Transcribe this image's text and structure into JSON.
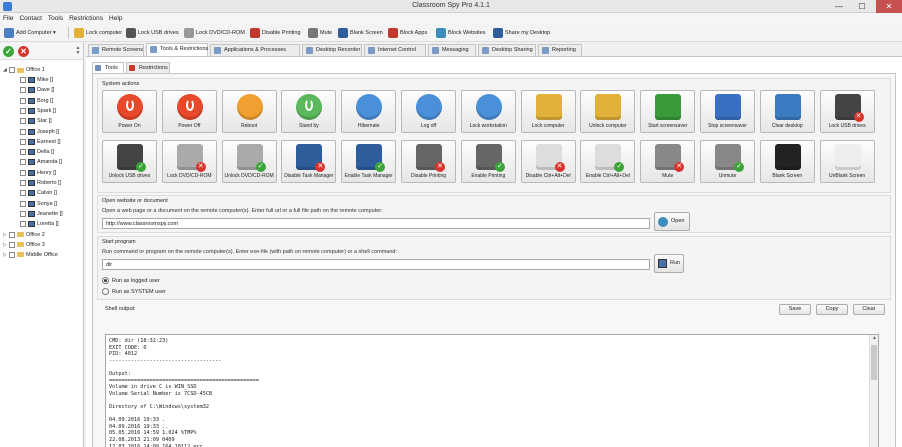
{
  "window": {
    "title": "Classroom Spy Pro 4.1.1",
    "minimize": "—",
    "maximize": "☐",
    "close": "✕"
  },
  "menu": [
    "File",
    "Contact",
    "Tools",
    "Restrictions",
    "Help"
  ],
  "toolbar": [
    {
      "label": "Add Computer ▾",
      "icon": "add-computer-icon",
      "color": "#4a7fc1"
    },
    {
      "label": "Lock computer",
      "icon": "lock-icon",
      "color": "#e0b23a"
    },
    {
      "label": "Lock USB drives",
      "icon": "usb-icon",
      "color": "#555555"
    },
    {
      "label": "Lock DVD/CD-ROM",
      "icon": "disc-icon",
      "color": "#999999"
    },
    {
      "label": "Disable Printing",
      "icon": "printer-icon",
      "color": "#c0392b"
    },
    {
      "label": "Mute",
      "icon": "speaker-icon",
      "color": "#777777"
    },
    {
      "label": "Blank Screen",
      "icon": "monitor-icon",
      "color": "#2f5d9c"
    },
    {
      "label": "Block Apps",
      "icon": "block-apps-icon",
      "color": "#c0392b"
    },
    {
      "label": "Block Websites",
      "icon": "globe-icon",
      "color": "#3c8dbc"
    },
    {
      "label": "Share my Desktop",
      "icon": "share-desktop-icon",
      "color": "#2f5d9c"
    }
  ],
  "tree": {
    "groups": [
      {
        "name": "Office 1",
        "expanded": true,
        "children": [
          "Mike []",
          "Dave []",
          "Borg []",
          "Spark []",
          "Star []",
          "Joseph []",
          "Earnest []",
          "Della []",
          "Amanda []",
          "Henry []",
          "Roberto []",
          "Calvin []",
          "Sonya []",
          "Jeanette []",
          "Loretta []"
        ]
      },
      {
        "name": "Office 2",
        "expanded": false,
        "children": []
      },
      {
        "name": "Office 3",
        "expanded": false,
        "children": []
      },
      {
        "name": "Middle Office",
        "expanded": false,
        "children": []
      }
    ]
  },
  "main_tabs": [
    "Remote Screens",
    "Tools & Restrictions",
    "Applications & Processes",
    "Desktop Recorder",
    "Internet Control",
    "Messaging",
    "Desktop Sharing",
    "Reporting"
  ],
  "active_main_tab": 1,
  "sub_tabs": [
    "Tools",
    "Restrictions"
  ],
  "system_actions": {
    "title": "System actions",
    "buttons": [
      {
        "label": "Power On",
        "icon": "power-on-icon",
        "color": "#e8492b"
      },
      {
        "label": "Power Off",
        "icon": "power-off-icon",
        "color": "#e8492b"
      },
      {
        "label": "Reboot",
        "icon": "reboot-icon",
        "color": "#f0a030"
      },
      {
        "label": "Stand by",
        "icon": "standby-icon",
        "color": "#5cb85c"
      },
      {
        "label": "Hibernate",
        "icon": "hibernate-icon",
        "color": "#4a90d9"
      },
      {
        "label": "Log off",
        "icon": "log-off-icon",
        "color": "#4a90d9"
      },
      {
        "label": "Lock workstation",
        "icon": "key-icon",
        "color": "#4a90d9"
      },
      {
        "label": "Lock computer",
        "icon": "padlock-closed-icon",
        "color": "#e0b23a"
      },
      {
        "label": "Unlock computer",
        "icon": "padlock-open-icon",
        "color": "#e0b23a"
      },
      {
        "label": "Start screensaver",
        "icon": "screensaver-start-icon",
        "color": "#3a9a3a"
      },
      {
        "label": "Stop screensaver",
        "icon": "screensaver-stop-icon",
        "color": "#3a6fc1"
      },
      {
        "label": "Clear desktop",
        "icon": "clear-desktop-icon",
        "color": "#3a7bc1"
      },
      {
        "label": "Lock USB drives",
        "icon": "usb-lock-icon",
        "color": "#444444"
      },
      {
        "label": "Unlock USB drives",
        "icon": "usb-unlock-icon",
        "color": "#444444"
      },
      {
        "label": "Lock DVD/CD-ROM",
        "icon": "dvd-lock-icon",
        "color": "#aaaaaa"
      },
      {
        "label": "Unlock DVD/CD-ROM",
        "icon": "dvd-unlock-icon",
        "color": "#aaaaaa"
      },
      {
        "label": "Disable Task Manager",
        "icon": "task-manager-disable-icon",
        "color": "#2f5d9c"
      },
      {
        "label": "Enable Task Manager",
        "icon": "task-manager-enable-icon",
        "color": "#2f5d9c"
      },
      {
        "label": "Disable Printing",
        "icon": "printer-disable-icon",
        "color": "#666666"
      },
      {
        "label": "Enable Printing",
        "icon": "printer-enable-icon",
        "color": "#666666"
      },
      {
        "label": "Disable Ctrl+Alt+Del",
        "icon": "cad-disable-icon",
        "color": "#dddddd"
      },
      {
        "label": "Enable Ctrl+Alt+Del",
        "icon": "cad-enable-icon",
        "color": "#dddddd"
      },
      {
        "label": "Mute",
        "icon": "mute-icon",
        "color": "#888888"
      },
      {
        "label": "Unmute",
        "icon": "unmute-icon",
        "color": "#888888"
      },
      {
        "label": "Blank Screen",
        "icon": "blank-screen-icon",
        "color": "#222222"
      },
      {
        "label": "UnBlank Screen",
        "icon": "unblank-screen-icon",
        "color": "#eeeeee"
      }
    ]
  },
  "open_website": {
    "title": "Open website or document",
    "instructions": "Open a web page or a document on the remote computer(s). Enter full url or a full file path on the remote computer:",
    "value": "http://www.classroomspy.com",
    "button": "Open"
  },
  "start_program": {
    "title": "Start program",
    "instructions": "Run command or program on the remote computer(s). Enter exe-file (with path on remote computer) or a shell command:",
    "value": "dir",
    "button": "Run",
    "options": [
      {
        "label": "Run as logged user",
        "checked": true
      },
      {
        "label": "Run as SYSTEM user",
        "checked": false
      }
    ]
  },
  "shell_output": {
    "title": "Shell output:",
    "buttons": [
      "Save",
      "Copy",
      "Clear"
    ],
    "lines": [
      "CMD: dir (18:32:23)",
      "EXIT CODE: 0",
      "PID: 4012",
      "------------------------------------",
      "",
      "Output:",
      "================================================",
      "Volume in drive C is WIN_SSD",
      "Volume Serial Number is 7CSD-45CB",
      "",
      "Directory of C:\\Windows\\system32",
      "",
      "04.09.2016 19:33 .",
      "04.09.2016 19:33 ..",
      "05.05.2016 14:59 1.024 %TMP%",
      "22.08.2013 21:09 0409",
      "12.03.2016 14:09 164 10112.err",
      "12.03.2016 14:43 82 10252.err",
      "12.03.2016 13:55 164 10276.err"
    ]
  }
}
